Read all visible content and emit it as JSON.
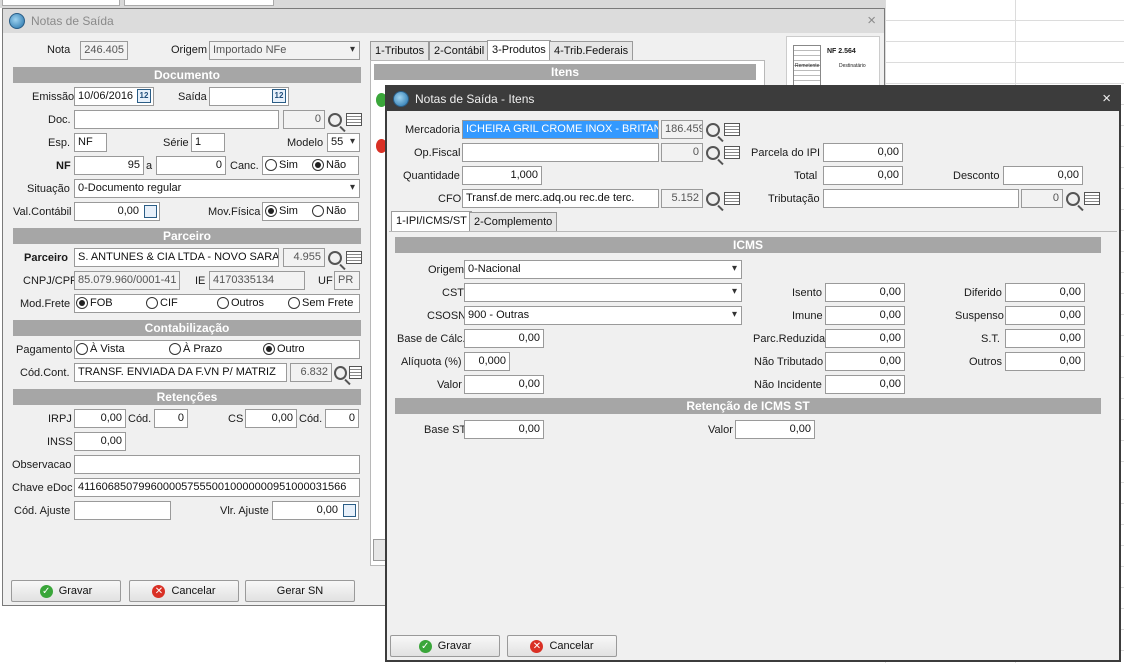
{
  "win1": {
    "title": "Notas de Saída",
    "close": "×",
    "nota_label": "Nota",
    "nota_value": "246.405",
    "origem_label": "Origem",
    "origem_value": "Importado NFe",
    "tabs": [
      "1-Tributos",
      "2-Contábil",
      "3-Produtos",
      "4-Trib.Federais"
    ],
    "itens_header": "Itens",
    "documento_header": "Documento",
    "emissao_label": "Emissão",
    "emissao_value": "10/06/2016",
    "saida_label": "Saída",
    "saida_value": "",
    "doc_label": "Doc.",
    "doc_value": "",
    "doc_code": "0",
    "esp_label": "Esp.",
    "esp_value": "NF",
    "serie_label": "Série",
    "serie_value": "1",
    "modelo_label": "Modelo",
    "modelo_value": "55",
    "nf_label": "NF",
    "nf_value": "95",
    "a_label": "a",
    "nf_to_value": "0",
    "canc_label": "Canc.",
    "sim": "Sim",
    "nao": "Não",
    "situacao_label": "Situação",
    "situacao_value": "0-Documento regular",
    "valcontabil_label": "Val.Contábil",
    "valcontabil_value": "0,00",
    "movfisica_label": "Mov.Física",
    "parceiro_header": "Parceiro",
    "parceiro_label": "Parceiro",
    "parceiro_value": "S. ANTUNES & CIA LTDA - NOVO SARAND",
    "parceiro_code": "4.955",
    "cnpj_label": "CNPJ/CPF",
    "cnpj_value": "85.079.960/0001-41",
    "ie_label": "IE",
    "ie_value": "4170335134",
    "uf_label": "UF",
    "uf_value": "PR",
    "modfrete_label": "Mod.Frete",
    "fob": "FOB",
    "cif": "CIF",
    "outros": "Outros",
    "semfrete": "Sem Frete",
    "contab_header": "Contabilização",
    "pagamento_label": "Pagamento",
    "avista": "À Vista",
    "aprazo": "À Prazo",
    "outro": "Outro",
    "codcont_label": "Cód.Cont.",
    "codcont_value": "TRANSF. ENVIADA DA F.VN P/  MATRIZ",
    "codcont_code": "6.832",
    "retencoes_header": "Retenções",
    "irpj_label": "IRPJ",
    "irpj_value": "0,00",
    "cod1_label": "Cód.",
    "cod1_value": "0",
    "cs_label": "CS",
    "cs_value": "0,00",
    "cod2_label": "Cód.",
    "cod2_value": "0",
    "inss_label": "INSS",
    "inss_value": "0,00",
    "obs_label": "Observacao",
    "obs_value": "",
    "chave_label": "Chave eDoc",
    "chave_value": "41160685079960000575550010000000951000031566",
    "codajuste_label": "Cód. Ajuste",
    "codajuste_value": "",
    "vlrajuste_label": "Vlr. Ajuste",
    "vlrajuste_value": "0,00",
    "gravar": "Gravar",
    "cancelar": "Cancelar",
    "gerarsn": "Gerar SN",
    "thumb_nf": "NF 2.564",
    "thumb_remetente": "Remetente",
    "thumb_destinatario": "Destinatário"
  },
  "win2": {
    "title": "Notas de Saída - Itens",
    "close": "×",
    "mercadoria_label": "Mercadoria",
    "mercadoria_value": "ICHEIRA GRIL CROME INOX - BRITANIA",
    "mercadoria_code": "186.459",
    "opfiscal_label": "Op.Fiscal",
    "opfiscal_value": "",
    "opfiscal_code": "0",
    "parcelaipi_label": "Parcela do IPI",
    "parcelaipi_value": "0,00",
    "quantidade_label": "Quantidade",
    "quantidade_value": "1,000",
    "total_label": "Total",
    "total_value": "0,00",
    "desconto_label": "Desconto",
    "desconto_value": "0,00",
    "cfo_label": "CFO",
    "cfo_value": "Transf.de merc.adq.ou rec.de terc.",
    "cfo_code": "5.152",
    "tributacao_label": "Tributação",
    "tributacao_value": "",
    "tributacao_code": "0",
    "tabs": [
      "1-IPI/ICMS/ST",
      "2-Complemento"
    ],
    "icms_header": "ICMS",
    "origem_label": "Origem",
    "origem_value": "0-Nacional",
    "cst_label": "CST",
    "cst_value": "",
    "csosn_label": "CSOSN",
    "csosn_value": "900 - Outras",
    "basecalc_label": "Base de Cálc.",
    "basecalc_value": "0,00",
    "aliquota_label": "Alíquota (%)",
    "aliquota_value": "0,000",
    "valor_label": "Valor",
    "valor_value": "0,00",
    "isento_label": "Isento",
    "isento_value": "0,00",
    "imune_label": "Imune",
    "imune_value": "0,00",
    "parcred_label": "Parc.Reduzida",
    "parcred_value": "0,00",
    "naotrib_label": "Não Tributado",
    "naotrib_value": "0,00",
    "naoinc_label": "Não Incidente",
    "naoinc_value": "0,00",
    "diferido_label": "Diferido",
    "diferido_value": "0,00",
    "suspenso_label": "Suspenso",
    "suspenso_value": "0,00",
    "st_label": "S.T.",
    "st_value": "0,00",
    "outros_label": "Outros",
    "outros_value": "0,00",
    "retst_header": "Retenção de ICMS ST",
    "basest_label": "Base ST",
    "basest_value": "0,00",
    "valorst_label": "Valor",
    "valorst_value": "0,00",
    "gravar": "Gravar",
    "cancelar": "Cancelar"
  }
}
